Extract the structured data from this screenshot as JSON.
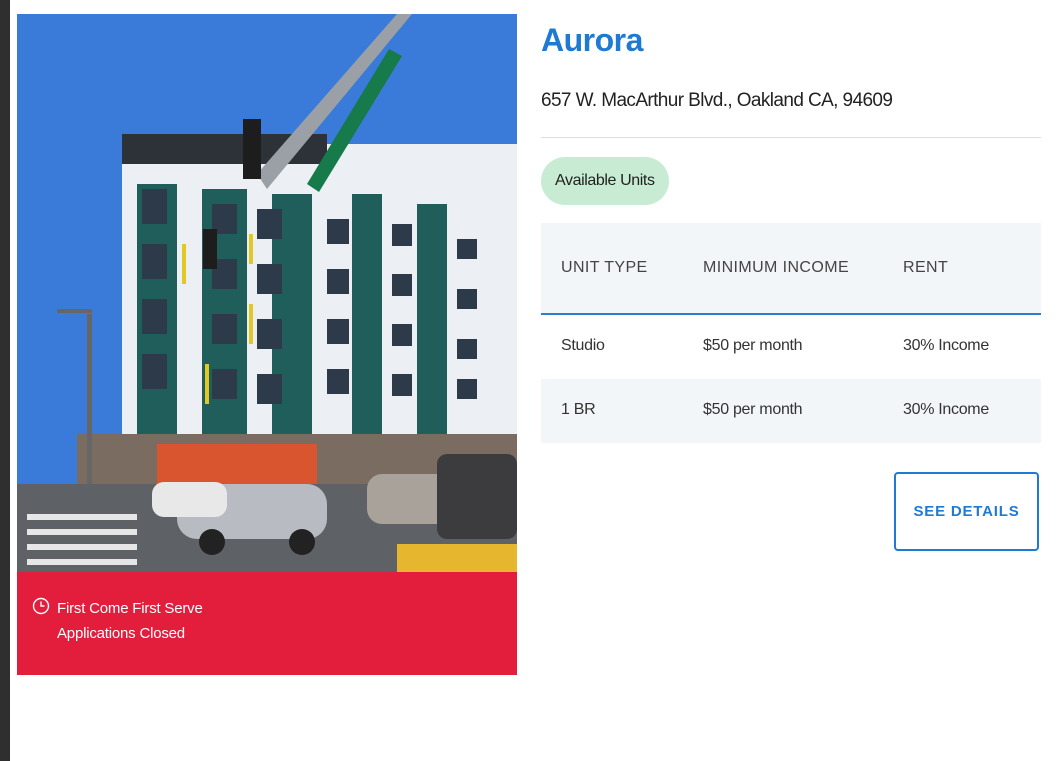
{
  "listing": {
    "name": "Aurora",
    "address": "657 W. MacArthur Blvd., Oakland CA, 94609",
    "badge": "Available Units",
    "status_line1": "First Come First Serve",
    "status_line2": "Applications Closed",
    "details_button": "SEE DETAILS"
  },
  "units_table": {
    "headers": [
      "UNIT TYPE",
      "MINIMUM INCOME",
      "RENT"
    ],
    "rows": [
      [
        "Studio",
        "$50 per month",
        "30% Income"
      ],
      [
        "1 BR",
        "$50 per month",
        "30% Income"
      ]
    ]
  },
  "colors": {
    "brand_blue": "#1e7ad3",
    "status_red": "#e21e3c",
    "badge_green": "#c8ecd3"
  }
}
